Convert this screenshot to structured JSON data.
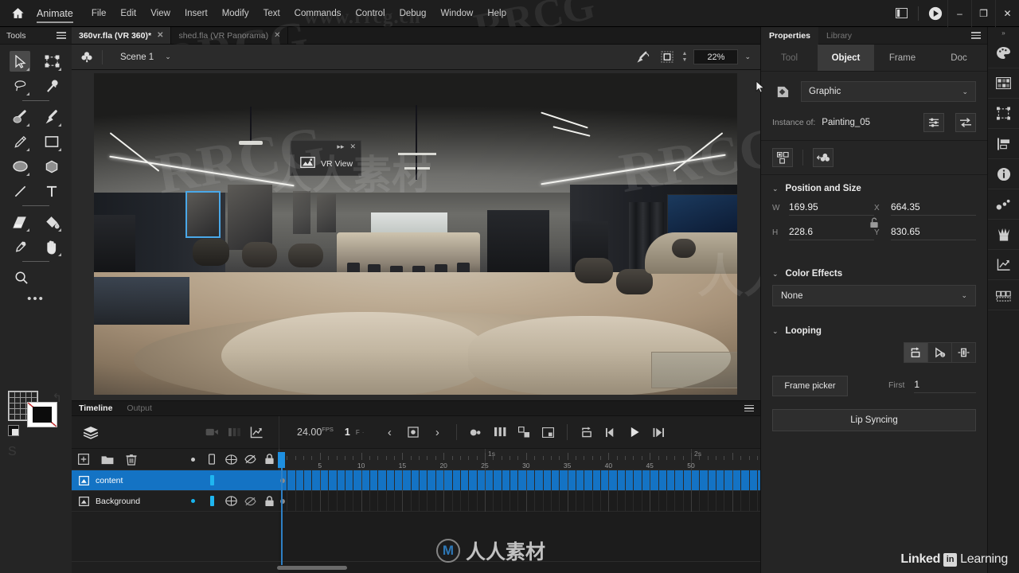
{
  "app": {
    "name": "Animate",
    "home_icon": "home-icon"
  },
  "menu": {
    "items": [
      "File",
      "Edit",
      "View",
      "Insert",
      "Modify",
      "Text",
      "Commands",
      "Control",
      "Debug",
      "Window",
      "Help"
    ]
  },
  "window_controls": {
    "layout_icon": "panel-layout-icon",
    "play_icon": "play-circle-icon",
    "minimize": "–",
    "maximize": "❐",
    "close": "✕"
  },
  "tools": {
    "title": "Tools",
    "menu_icon": "hamburger-icon",
    "rows": [
      [
        "selection-tool",
        "free-transform-tool"
      ],
      [
        "lasso-tool",
        "asset-warp-tool"
      ],
      [
        "brush-tool",
        "paint-brush-tool"
      ],
      [
        "pencil-tool",
        "rectangle-tool"
      ],
      [
        "oval-tool",
        "polystar-tool"
      ],
      [
        "line-tool",
        "text-tool"
      ],
      [
        "eraser-tool",
        "paint-bucket-tool"
      ],
      [
        "eyedropper-tool",
        "hand-tool"
      ],
      [
        "zoom-tool"
      ]
    ],
    "more": "•••",
    "ghost_letters": "S"
  },
  "doc_tabs": [
    {
      "label": "360vr.fla (VR 360)*",
      "active": true,
      "close": "✕"
    },
    {
      "label": "shed.fla (VR Panorama)",
      "active": false,
      "close": "✕"
    }
  ],
  "edit_bar": {
    "scene_icon": "scene-symbol-icon",
    "scene_name": "Scene 1",
    "caret": "⌄",
    "rotate_icon": "rotate-stage-icon",
    "clip_icon": "clip-to-stage-icon",
    "zoom_value": "22%",
    "zoom_caret": "⌄"
  },
  "vr_view": {
    "label": "VR View",
    "icon": "vr-panorama-icon",
    "collapse": "▸▸",
    "close": "✕"
  },
  "timeline": {
    "tabs": [
      {
        "label": "Timeline",
        "active": true
      },
      {
        "label": "Output",
        "active": false
      }
    ],
    "menu_icon": "hamburger-icon",
    "controls": {
      "layers_icon": "layers-icon",
      "camera_icon": "camera-icon",
      "onion_icon": "onion-skin-icon",
      "graph_icon": "graph-editor-icon",
      "fps_value": "24.00",
      "fps_unit": "FPS",
      "current_frame": "1",
      "frame_suffix": "F",
      "frame_suffix_small": "·",
      "prev_keyframe": "‹",
      "insert_keyframe_icon": "insert-keyframe-icon",
      "next_keyframe": "›",
      "tween_icon": "create-tween-icon",
      "frames_icon": "insert-frame-icon",
      "reshape_icon": "reshape-tween-icon",
      "mark_icon": "frame-marker-icon",
      "loop_icon": "loop-playback-icon",
      "step_back_icon": "step-back-icon",
      "play_icon": "play-icon",
      "step_forward_icon": "step-forward-icon"
    },
    "layer_tools": [
      "add-layer-icon",
      "new-folder-icon",
      "delete-layer-icon"
    ],
    "layer_columns": [
      "keyframe-dot",
      "outline-bar",
      "show-all-icon",
      "hide-icon",
      "lock-icon"
    ],
    "layers": [
      {
        "name": "content",
        "selected": true,
        "dot": false,
        "bar": true,
        "icons": false
      },
      {
        "name": "Background",
        "selected": false,
        "dot": true,
        "bar": true,
        "icons": true
      }
    ],
    "ruler": {
      "second_labels": [
        "1s",
        "2s"
      ],
      "frame_labels": [
        "5",
        "10",
        "15",
        "20",
        "25",
        "30",
        "35",
        "40",
        "45",
        "50"
      ]
    }
  },
  "properties": {
    "tabs": [
      {
        "label": "Properties",
        "active": true
      },
      {
        "label": "Library",
        "active": false
      }
    ],
    "menu_icon": "hamburger-icon",
    "segments": [
      {
        "label": "Tool",
        "active": false,
        "dim": true
      },
      {
        "label": "Object",
        "active": true,
        "dim": false
      },
      {
        "label": "Frame",
        "active": false,
        "dim": false
      },
      {
        "label": "Doc",
        "active": false,
        "dim": false
      }
    ],
    "symbol": {
      "icon": "symbol-graphic-icon",
      "type": "Graphic",
      "caret": "⌄",
      "instance_label": "Instance of:",
      "instance_value": "Painting_05",
      "swap_settings_icon": "instance-settings-icon",
      "swap_icon": "swap-symbol-icon"
    },
    "icon_row": [
      "break-apart-icon",
      "duplicate-symbol-icon"
    ],
    "position_and_size": {
      "title": "Position and Size",
      "caret": "⌄",
      "lock_icon": "unlock-icon",
      "W_label": "W",
      "W_value": "169.95",
      "X_label": "X",
      "X_value": "664.35",
      "H_label": "H",
      "H_value": "228.6",
      "Y_label": "Y",
      "Y_value": "830.65"
    },
    "color_effects": {
      "title": "Color Effects",
      "caret": "⌄",
      "value": "None",
      "value_caret": "⌄"
    },
    "looping": {
      "title": "Looping",
      "caret": "⌄",
      "buttons": [
        "loop-icon",
        "play-once-icon",
        "single-frame-icon"
      ],
      "active_button": 0,
      "frame_picker_label": "Frame picker",
      "first_label": "First",
      "first_value": "1",
      "lip_syncing_label": "Lip Syncing"
    }
  },
  "rail": {
    "items": [
      "color-palette-icon",
      "swatches-icon",
      "transform-icon",
      "align-icon",
      "info-icon",
      "motion-presets-icon",
      "brush-library-icon",
      "graph-editor-icon",
      "frame-picker-icon"
    ]
  },
  "branding": {
    "linkedin_part1": "Linked",
    "linkedin_badge": "in",
    "linkedin_part2": "Learning",
    "center_mark": "人人素材",
    "center_circle": "M"
  },
  "watermarks": {
    "url": "www.rrcg.cn",
    "rrcg": "RRCG",
    "cn": "人人素材"
  }
}
